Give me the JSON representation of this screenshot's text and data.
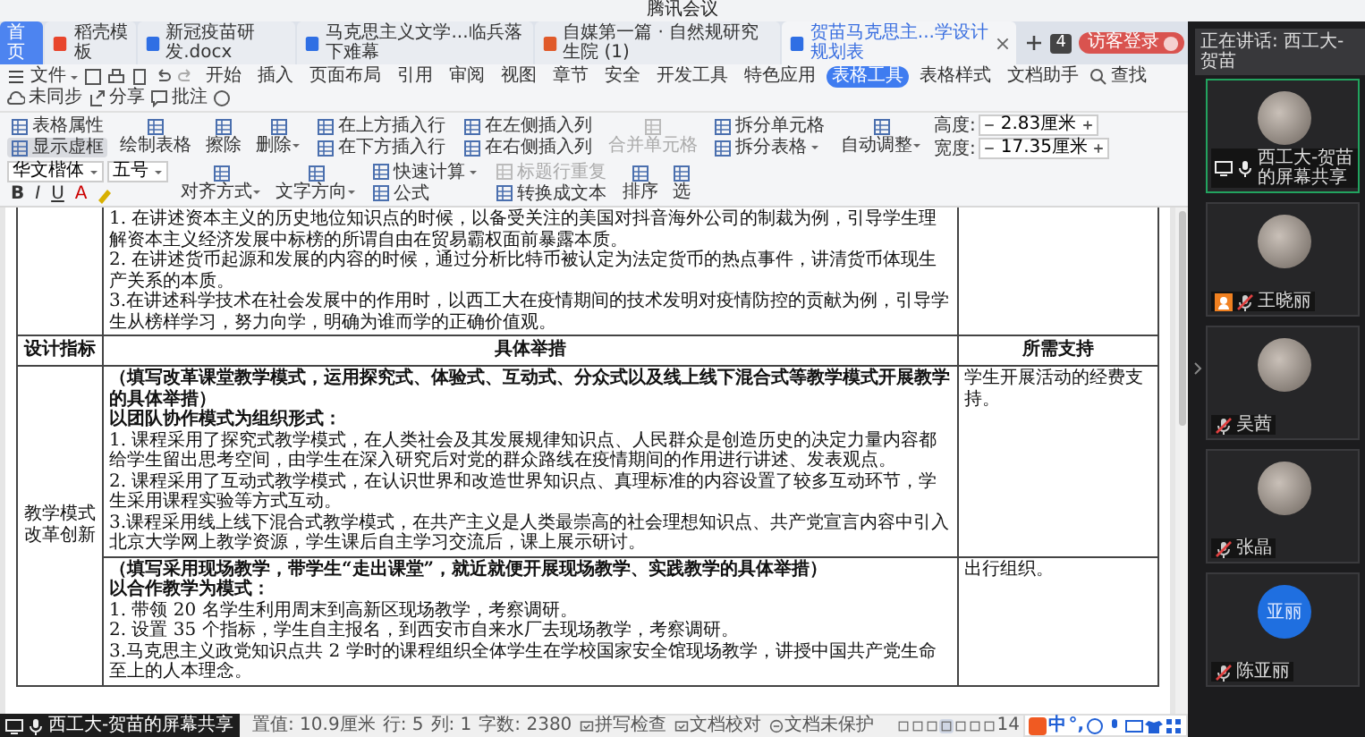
{
  "app_title": "腾讯会议",
  "wps": {
    "tabs": [
      {
        "kind": "home",
        "label": "首页",
        "selected": false
      },
      {
        "kind": "docer",
        "label": "稻壳模板",
        "selected": false
      },
      {
        "kind": "doc",
        "label": "新冠疫苗研发.docx",
        "selected": false
      },
      {
        "kind": "doc",
        "label": "马克思主义文学...临兵落下难幕",
        "selected": false
      },
      {
        "kind": "pdf",
        "label": "自媒第一篇 · 自然规研究生院 (1)",
        "selected": false
      },
      {
        "kind": "doc",
        "label": "贺苗马克思主...学设计规划表",
        "selected": true
      }
    ],
    "tab_count": "4",
    "login": "访客登录",
    "file_menu": "文件",
    "menu": [
      {
        "label": "开始",
        "selected": false
      },
      {
        "label": "插入",
        "selected": false
      },
      {
        "label": "页面布局",
        "selected": false
      },
      {
        "label": "引用",
        "selected": false
      },
      {
        "label": "审阅",
        "selected": false
      },
      {
        "label": "视图",
        "selected": false
      },
      {
        "label": "章节",
        "selected": false
      },
      {
        "label": "安全",
        "selected": false
      },
      {
        "label": "开发工具",
        "selected": false
      },
      {
        "label": "特色应用",
        "selected": false
      },
      {
        "label": "表格工具",
        "selected": true
      },
      {
        "label": "表格样式",
        "selected": false
      },
      {
        "label": "文档助手",
        "selected": false
      }
    ],
    "search": "查找",
    "actions": [
      {
        "kind": "cloud",
        "label": "未同步"
      },
      {
        "kind": "share",
        "label": "分享"
      },
      {
        "kind": "comment",
        "label": "批注"
      }
    ],
    "ribbon": [
      {
        "kind": "stack",
        "items": [
          {
            "label": "表格属性",
            "on": false
          },
          {
            "label": "显示虚框",
            "on": true
          }
        ]
      },
      {
        "kind": "large",
        "label": "绘制表格"
      },
      {
        "kind": "large",
        "label": "擦除"
      },
      {
        "kind": "large",
        "label": "删除",
        "dropdown": true
      },
      {
        "kind": "stack",
        "items": [
          {
            "label": "在上方插入行"
          },
          {
            "label": "在下方插入行"
          }
        ]
      },
      {
        "kind": "stack",
        "items": [
          {
            "label": "在左侧插入列"
          },
          {
            "label": "在右侧插入列"
          }
        ]
      },
      {
        "kind": "large",
        "label": "合并单元格",
        "disabled": true
      },
      {
        "kind": "stack",
        "items": [
          {
            "label": "拆分单元格"
          },
          {
            "label": "拆分表格",
            "dropdown": true
          }
        ]
      },
      {
        "kind": "large",
        "label": "自动调整",
        "dropdown": true
      },
      {
        "kind": "size",
        "items": [
          {
            "label": "高度:",
            "value": "2.83厘米"
          },
          {
            "label": "宽度:",
            "value": "17.35厘米"
          }
        ]
      },
      {
        "kind": "font",
        "font": "华文楷体",
        "size": "五号",
        "format": [
          "B",
          "I",
          "U",
          "A"
        ]
      },
      {
        "kind": "large",
        "label": "对齐方式",
        "dropdown": true
      },
      {
        "kind": "large",
        "label": "文字方向",
        "dropdown": true
      },
      {
        "kind": "stack",
        "items": [
          {
            "label": "快速计算",
            "dropdown": true
          },
          {
            "label": "公式"
          }
        ]
      },
      {
        "kind": "stack",
        "items": [
          {
            "label": "标题行重复",
            "disabled": true
          },
          {
            "label": "转换成文本"
          }
        ]
      },
      {
        "kind": "large",
        "label": "排序"
      },
      {
        "kind": "large",
        "label": "选"
      }
    ],
    "table": {
      "top_paragraphs": [
        {
          "text": "1. 在讲述资本主义的历史地位知识点的时候，以备受关注的美国对抖音海外公司的制裁为例，引导学生理解资本主义经济发展中标榜的所谓自由在贸易霸权面前暴露本质。",
          "bold": false
        },
        {
          "text": "2. 在讲述货币起源和发展的内容的时候，通过分析比特币被认定为法定货币的热点事件，讲清货币体现生产关系的本质。",
          "bold": false
        },
        {
          "text": "3.在讲述科学技术在社会发展中的作用时，以西工大在疫情期间的技术发明对疫情防控的贡献为例，引导学生从榜样学习，努力向学，明确为谁而学的正确价值观。",
          "bold": false
        }
      ],
      "header": [
        "设计指标",
        "具体举措",
        "所需支持"
      ],
      "group_label": "教学模式改革创新",
      "blocks": [
        {
          "paragraphs": [
            {
              "text": "（填写改革课堂教学模式，运用探究式、体验式、互动式、分众式以及线上线下混合式等教学模式开展教学的具体举措）",
              "bold": true
            },
            {
              "text": "以团队协作模式为组织形式：",
              "bold": true
            },
            {
              "text": "1. 课程采用了探究式教学模式，在人类社会及其发展规律知识点、人民群众是创造历史的决定力量内容都给学生留出思考空间，由学生在深入研究后对党的群众路线在疫情期间的作用进行讲述、发表观点。",
              "bold": false
            },
            {
              "text": "2. 课程采用了互动式教学模式，在认识世界和改造世界知识点、真理标准的内容设置了较多互动环节，学生采用课程实验等方式互动。",
              "bold": false
            },
            {
              "text": "3.课程采用线上线下混合式教学模式，在共产主义是人类最崇高的社会理想知识点、共产党宣言内容中引入北京大学网上教学资源，学生课后自主学习交流后，课上展示研讨。",
              "bold": false
            }
          ],
          "support": "学生开展活动的经费支持。"
        },
        {
          "paragraphs": [
            {
              "text": "（填写采用现场教学，带学生“走出课堂”，就近就便开展现场教学、实践教学的具体举措）",
              "bold": true
            },
            {
              "text": "以合作教学为模式：",
              "bold": true
            },
            {
              "text": "1. 带领 20 名学生利用周末到高新区现场教学，考察调研。",
              "bold": false
            },
            {
              "text": "2. 设置 35 个指标，学生自主报名，到西安市自来水厂去现场教学，考察调研。",
              "bold": false
            },
            {
              "text": "3.马克思主义政党知识点共 2 学时的课程组织全体学生在学校国家安全馆现场教学，讲授中国共产党生命至上的人本理念。",
              "bold": false
            }
          ],
          "support": "出行组织。"
        }
      ]
    }
  },
  "status_bar": {
    "items": [
      {
        "kind": "text",
        "label": "置值: 10.9厘米"
      },
      {
        "kind": "text",
        "label": "行: 5"
      },
      {
        "kind": "text",
        "label": "列: 1"
      },
      {
        "kind": "text",
        "label": "字数: 2380"
      },
      {
        "kind": "check",
        "label": "拼写检查"
      },
      {
        "kind": "check",
        "label": "文档校对"
      },
      {
        "kind": "lock",
        "label": "文档未保护"
      }
    ],
    "views": [
      {
        "selected": false
      },
      {
        "selected": false
      },
      {
        "selected": false
      },
      {
        "selected": true
      },
      {
        "selected": false
      },
      {
        "selected": false
      },
      {
        "selected": false
      }
    ],
    "zoom": "14"
  },
  "share_badge": "西工大-贺苗的屏幕共享",
  "ime": {
    "mode": "中",
    "punctuation": "°,"
  },
  "panel": {
    "speaking": "正在讲话: 西工大-贺苗",
    "participants": [
      {
        "name": "西工大-贺苗的屏幕共享",
        "sharing": true,
        "active": true,
        "muted": false,
        "host": false
      },
      {
        "name": "王晓丽",
        "active": false,
        "muted": true,
        "host": true
      },
      {
        "name": "吴茜",
        "active": false,
        "muted": true,
        "host": false
      },
      {
        "name": "张晶",
        "active": false,
        "muted": true,
        "host": false
      },
      {
        "name": "陈亚丽",
        "avatar_text": "亚丽",
        "active": false,
        "muted": true,
        "host": false
      }
    ]
  }
}
